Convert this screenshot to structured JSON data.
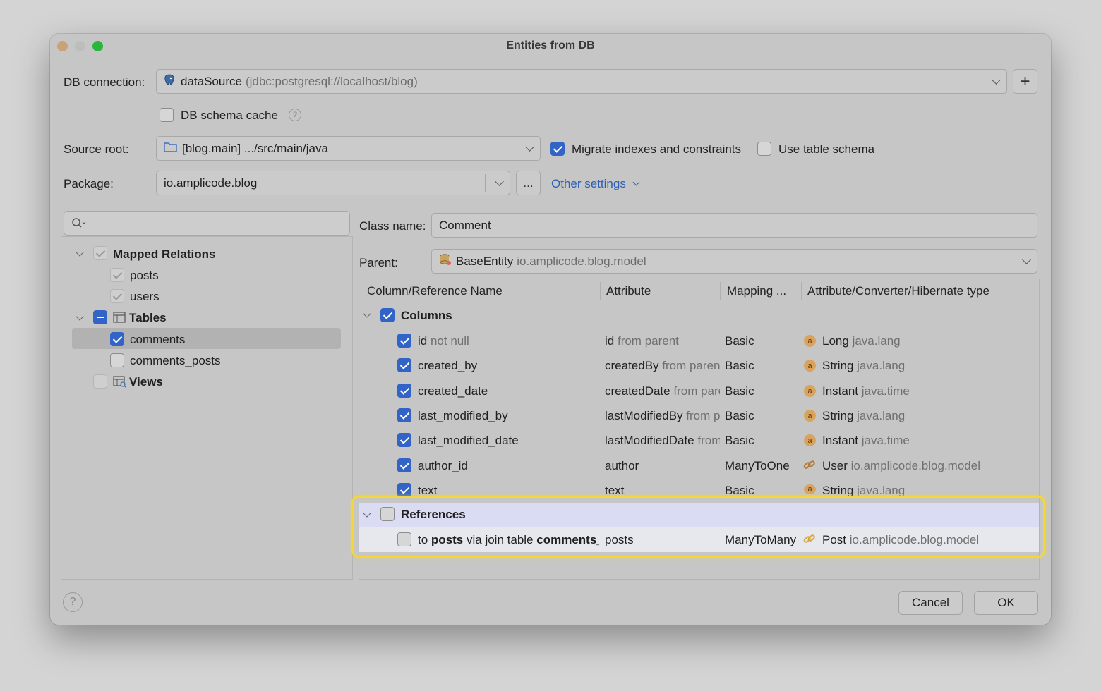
{
  "window": {
    "title": "Entities from DB"
  },
  "db_connection": {
    "label": "DB connection:",
    "name": "dataSource",
    "url": "(jdbc:postgresql://localhost/blog)",
    "add_button": "+"
  },
  "schema_cache": {
    "label": "DB schema cache",
    "checked": false
  },
  "source_root": {
    "label": "Source root:",
    "value": "[blog.main] .../src/main/java"
  },
  "migrate": {
    "label": "Migrate indexes and constraints",
    "checked": true
  },
  "table_schema": {
    "label": "Use table schema",
    "checked": false
  },
  "package": {
    "label": "Package:",
    "value": "io.amplicode.blog",
    "browse_label": "...",
    "other_settings": "Other settings"
  },
  "tree": {
    "mapped_relations": "Mapped Relations",
    "mapped_items": [
      "posts",
      "users"
    ],
    "tables": "Tables",
    "table_items": [
      "comments",
      "comments_posts"
    ],
    "views": "Views"
  },
  "class_name": {
    "label": "Class name:",
    "value": "Comment"
  },
  "parent": {
    "label": "Parent:",
    "name": "BaseEntity",
    "pkg": "io.amplicode.blog.model"
  },
  "table": {
    "headers": [
      "Column/Reference Name",
      "Attribute",
      "Mapping ...",
      "Attribute/Converter/Hibernate type"
    ],
    "columns_group": "Columns",
    "rows": [
      {
        "name": "id",
        "name_extra": "not null",
        "attr": "id",
        "attr_extra": "from parent",
        "mapping": "Basic",
        "type": "Long",
        "type_pkg": "java.lang",
        "icon": "a"
      },
      {
        "name": "created_by",
        "name_extra": "",
        "attr": "createdBy",
        "attr_extra": "from parent",
        "mapping": "Basic",
        "type": "String",
        "type_pkg": "java.lang",
        "icon": "a"
      },
      {
        "name": "created_date",
        "name_extra": "",
        "attr": "createdDate",
        "attr_extra": "from parent",
        "mapping": "Basic",
        "type": "Instant",
        "type_pkg": "java.time",
        "icon": "a"
      },
      {
        "name": "last_modified_by",
        "name_extra": "",
        "attr": "lastModifiedBy",
        "attr_extra": "from parent",
        "mapping": "Basic",
        "type": "String",
        "type_pkg": "java.lang",
        "icon": "a"
      },
      {
        "name": "last_modified_date",
        "name_extra": "",
        "attr": "lastModifiedDate",
        "attr_extra": "from parent",
        "mapping": "Basic",
        "type": "Instant",
        "type_pkg": "java.time",
        "icon": "a"
      },
      {
        "name": "author_id",
        "name_extra": "",
        "attr": "author",
        "attr_extra": "",
        "mapping": "ManyToOne",
        "type": "User",
        "type_pkg": "io.amplicode.blog.model",
        "icon": "link"
      },
      {
        "name": "text",
        "name_extra": "",
        "attr": "text",
        "attr_extra": "",
        "mapping": "Basic",
        "type": "String",
        "type_pkg": "java.lang",
        "icon": "a"
      }
    ],
    "references_group": "References",
    "reference": {
      "pre": "to",
      "target": "posts",
      "mid": "via join table",
      "join": "comments_posts",
      "attr": "posts",
      "mapping": "ManyToMany",
      "type": "Post",
      "type_pkg": "io.amplicode.blog.model"
    }
  },
  "footer": {
    "cancel": "Cancel",
    "ok": "OK",
    "help": "?"
  }
}
